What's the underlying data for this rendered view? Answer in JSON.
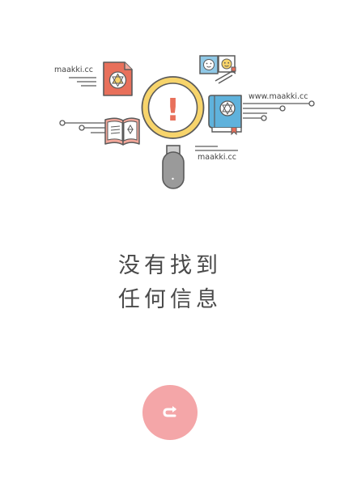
{
  "empty_state": {
    "line1": "没有找到",
    "line2": "任何信息"
  },
  "illustration": {
    "label_left": "maakki.cc",
    "label_right": "www.maakki.cc",
    "label_bottom": "maakki.cc",
    "alert_glyph": "!"
  },
  "refresh_button": {
    "icon": "refresh-icon"
  },
  "colors": {
    "accent": "#f4a6a8",
    "outline": "#5a5a5a",
    "lens_yellow": "#f7d46b",
    "book_blue": "#5fb2dc",
    "red": "#e8705b",
    "text": "#4a4a4a"
  }
}
